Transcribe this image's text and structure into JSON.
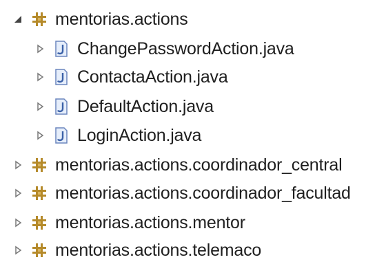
{
  "tree": {
    "items": [
      {
        "label": "mentorias.actions",
        "type": "package",
        "expanded": true,
        "level": 0,
        "icon": "package-icon",
        "toggle_icon": "expanded-triangle-icon"
      },
      {
        "label": "ChangePasswordAction.java",
        "type": "java-file",
        "expanded": false,
        "level": 1,
        "icon": "java-file-icon",
        "toggle_icon": "collapsed-triangle-icon"
      },
      {
        "label": "ContactaAction.java",
        "type": "java-file",
        "expanded": false,
        "level": 1,
        "icon": "java-file-icon",
        "toggle_icon": "collapsed-triangle-icon"
      },
      {
        "label": "DefaultAction.java",
        "type": "java-file",
        "expanded": false,
        "level": 1,
        "icon": "java-file-icon",
        "toggle_icon": "collapsed-triangle-icon"
      },
      {
        "label": "LoginAction.java",
        "type": "java-file",
        "expanded": false,
        "level": 1,
        "icon": "java-file-icon",
        "toggle_icon": "collapsed-triangle-icon"
      },
      {
        "label": "mentorias.actions.coordinador_central",
        "type": "package",
        "expanded": false,
        "level": 0,
        "icon": "package-icon",
        "toggle_icon": "collapsed-triangle-icon"
      },
      {
        "label": "mentorias.actions.coordinador_facultad",
        "type": "package",
        "expanded": false,
        "level": 0,
        "icon": "package-icon",
        "toggle_icon": "collapsed-triangle-icon"
      },
      {
        "label": "mentorias.actions.mentor",
        "type": "package",
        "expanded": false,
        "level": 0,
        "icon": "package-icon",
        "toggle_icon": "collapsed-triangle-icon"
      },
      {
        "label": "mentorias.actions.telemaco",
        "type": "package",
        "expanded": false,
        "level": 0,
        "icon": "package-icon",
        "toggle_icon": "collapsed-triangle-icon"
      }
    ]
  },
  "colors": {
    "package_brown": "#b58a2a",
    "package_highlight": "#d9b45e",
    "java_blue": "#3b61a8",
    "java_border": "#6b86be",
    "java_fill": "#e6eefb",
    "toggle_gray": "#7a7a7a",
    "toggle_dark": "#444444"
  }
}
